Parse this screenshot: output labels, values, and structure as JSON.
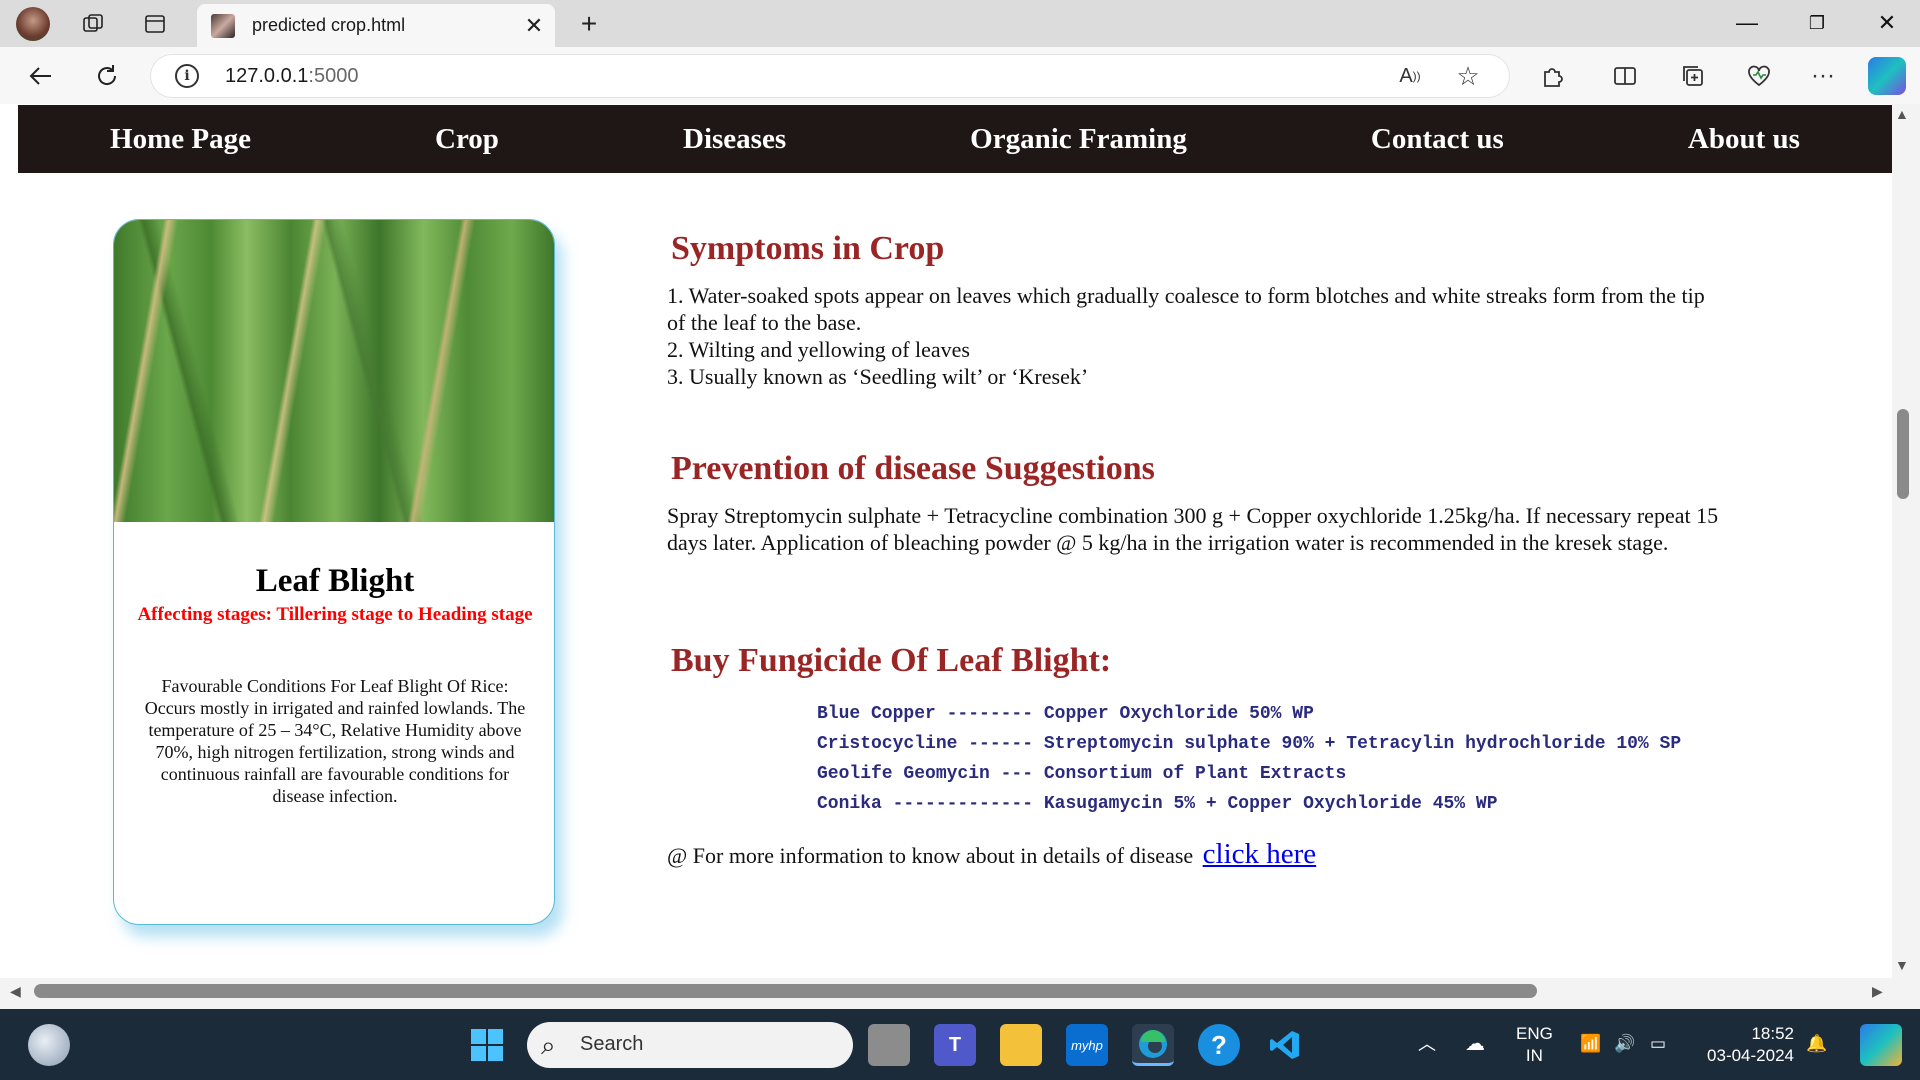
{
  "browser": {
    "tab_title": "predicted crop.html",
    "url_host": "127.0.0.1",
    "url_port": ":5000",
    "icons": [
      "profile-avatar",
      "workspaces-icon",
      "tab-actions-icon",
      "back-icon",
      "refresh-icon",
      "info-icon",
      "read-aloud-icon",
      "favorite-star-icon",
      "extensions-icon",
      "split-screen-icon",
      "collections-icon",
      "browser-essentials-icon",
      "more-icon",
      "copilot-icon"
    ]
  },
  "nav": {
    "items": [
      "Home Page",
      "Crop",
      "Diseases",
      "Organic Framing",
      "Contact us",
      "About us"
    ]
  },
  "card": {
    "title": "Leaf Blight",
    "stage": "Affecting stages: Tillering stage to Heading stage",
    "description": "Favourable Conditions For Leaf Blight Of Rice: Occurs mostly in irrigated and rainfed lowlands. The temperature of 25 – 34°C, Relative Humidity above 70%, high nitrogen fertilization, strong winds and continuous rainfall are favourable conditions for disease infection."
  },
  "symptoms": {
    "title": "Symptoms in Crop",
    "lines": [
      "1. Water-soaked spots appear on leaves which gradually coalesce to form blotches and white streaks form from the tip of the leaf to the base.",
      "2. Wilting and yellowing of leaves",
      "3. Usually known as ‘Seedling wilt’ or ‘Kresek’"
    ]
  },
  "prevention": {
    "title": "Prevention of disease Suggestions",
    "text": "Spray Streptomycin sulphate + Tetracycline combination 300 g + Copper oxychloride 1.25kg/ha. If necessary repeat 15 days later. Application of bleaching powder @ 5 kg/ha in the irrigation water is recommended in the kresek stage."
  },
  "fungicide": {
    "title": "Buy Fungicide Of Leaf Blight:",
    "items": [
      "Blue Copper -------- Copper Oxychloride 50% WP",
      "Cristocycline ------ Streptomycin sulphate 90% + Tetracylin hydrochloride 10% SP",
      "Geolife Geomycin --- Consortium of Plant Extracts",
      "Conika ------------- Kasugamycin 5% + Copper Oxychloride 45% WP"
    ]
  },
  "more_info": {
    "text": "@ For more information to know about in details of disease",
    "link": "click here"
  },
  "taskbar": {
    "search_label": "Search",
    "lang_top": "ENG",
    "lang_bottom": "IN",
    "time": "18:52",
    "date": "03-04-2024",
    "myhp": "myhp"
  },
  "colors": {
    "navbar_bg": "#1f1715",
    "heading": "#9a2525",
    "stage": "#ff0000",
    "fungicide": "#2b2b7e",
    "link": "#0000ee",
    "card_border": "#5bb8d8"
  }
}
